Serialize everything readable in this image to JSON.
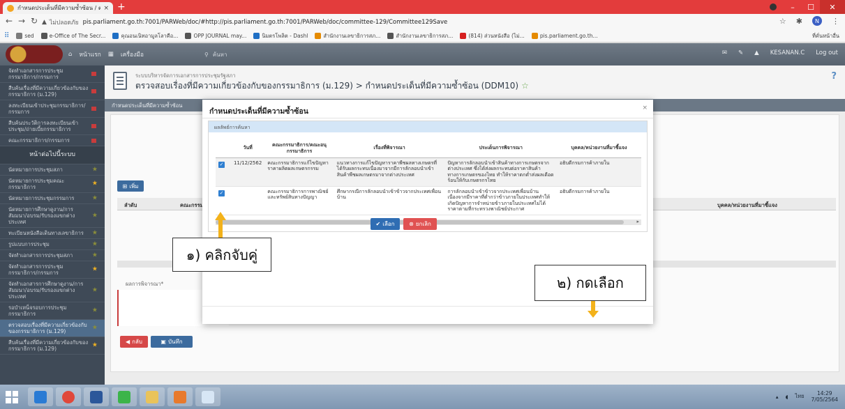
{
  "browser": {
    "tab_title": "กำหนดประเด็นที่มีความซ้ำซ้อน / ตรวจ",
    "tab_close": "×",
    "new_tab": "+",
    "not_secure": "ไม่ปลอดภัย",
    "url": "pis.parliament.go.th:7001/PARWeb/doc/#http://pis.parliament.go.th:7001/PARWeb/doc/committee-129/Committee129Save",
    "profile_initial": "N",
    "win_min": "–",
    "win_max": "☐",
    "win_close": "✕"
  },
  "bookmarks": {
    "items": [
      {
        "label": "sed",
        "color": "#7b7b7b"
      },
      {
        "label": "e-Office of The Secr...",
        "color": "#555555"
      },
      {
        "label": "คุณอนเนิทอามูลโลาคือ...",
        "color": "#1f6fc4"
      },
      {
        "label": "OPP JOURNAL may...",
        "color": "#555555"
      },
      {
        "label": "นิมตรโพลิต - Dashl",
        "color": "#1f6fc4"
      },
      {
        "label": "สำนักงานเลขาธิการสภ...",
        "color": "#e58a00"
      },
      {
        "label": "สำนักงานเลขาธิการสภ...",
        "color": "#555555"
      },
      {
        "label": "(814) ส่วนหนังสือ (ไม่...",
        "color": "#d62020"
      },
      {
        "label": "pis.parliament.go.th...",
        "color": "#e58a00"
      }
    ],
    "other": "ที่คั่นหน้าอื่น"
  },
  "app_header": {
    "home": "หน้าแรก",
    "apps": "เครื่องมือ",
    "search_placeholder": "ค้นหา",
    "user": "KESANAN.C",
    "logout": "Log out"
  },
  "sidebar": {
    "items": [
      {
        "label": "จัดทำเอกสารการประชุมกรรมาธิการ/กรรมการ",
        "mark": "red"
      },
      {
        "label": "สืบค้นเรื่องที่มีความเกี่ยวข้องกับของกรรมาธิการ (ม.129)",
        "mark": "red"
      },
      {
        "label": "ลงทะเบียนเข้าประชุมกรรมาธิการ/กรรมการ",
        "mark": "red"
      },
      {
        "label": "สืบค้นประวัติการลงทะเบียนเข้าประชุม/ถ่ายเบี้ยกรรมาธิการ",
        "mark": "red"
      },
      {
        "label": "คณะกรรมาธิการ/กรรมการ",
        "mark": "red"
      },
      {
        "label": "หน้าต่อไปนี้ระบบ",
        "mark": "head"
      },
      {
        "label": "นัดหมายการประชุมสภา",
        "mark": "star"
      },
      {
        "label": "นัดหมายการประชุมคณะกรรมาธิการ",
        "mark": "gold"
      },
      {
        "label": "นัดหมายการประชุมกรรมการ",
        "mark": "star"
      },
      {
        "label": "นัดหมายการศึกษาดูงาน/การสัมมนา/อบรม/รับรองแขกต่างประเทศ",
        "mark": "star"
      },
      {
        "label": "ทะเบียนหนังสือเดินทางเลขาธิการ",
        "mark": "star"
      },
      {
        "label": "รูปแบบการประชุม",
        "mark": "star"
      },
      {
        "label": "จัดทำเอกสารการประชุมสภา",
        "mark": "star"
      },
      {
        "label": "จัดทำเอกสารการประชุมกรรมาธิการ/กรรมการ",
        "mark": "gold"
      },
      {
        "label": "จัดทำเอกสารการศึกษาดูงาน/การสัมมนา/อบรม/รับรองแขกต่างประเทศ",
        "mark": "star"
      },
      {
        "label": "รอบำเหน็จรอบการประชุมกรรมาธิการ",
        "mark": "star"
      },
      {
        "label": "ตรวจสอบเรื่องที่มีความเกี่ยวข้องกับของกรรมาธิการ (ม.129)",
        "mark": "active"
      },
      {
        "label": "สืบค้นเรื่องที่มีความเกี่ยวข้องกับของกรรมาธิการ (ม.129)",
        "mark": "gold"
      }
    ]
  },
  "page": {
    "crumb": "ระบบบริหารจัดการเอกสารการประชุมรัฐสภา",
    "title": "ตรวจสอบเรื่องที่มีความเกี่ยวข้องกับของกรรมาธิการ (ม.129) > กำหนดประเด็นที่มีความซ้ำซ้อน (DDM10)",
    "help": "?",
    "tab_label": "กำหนดประเด็นที่มีความซ้ำซ้อน",
    "add_label": "เพิ่ม",
    "col_seq": "ลำดับ",
    "col_committee": "คณะกรรม",
    "col_person": "บุคคล/หน่วยงานที่มาชี้แจง",
    "consider_label": "ผลการพิจารณา*",
    "back_label": "กลับ",
    "save_label": "บันทึก"
  },
  "modal": {
    "title": "กำหนดประเด็นที่มีความซ้ำซ้อน",
    "close": "×",
    "result_header": "ผลลัพธ์การค้นหา",
    "columns": [
      "วันที่",
      "คณะกรรมาธิการ/คณะอนุกรรมาธิการ",
      "เรื่องที่พิจารณา",
      "ประเด็นการพิจารณา",
      "บุคคล/หน่วยงานที่มาชี้แจง"
    ],
    "rows": [
      {
        "checked": true,
        "date": "11/12/2562",
        "committee": "คณะกรรมาธิการแก้ไขปัญหาราคาผลิตผลเกษตรกรรม",
        "subject": "แนวทางการแก้ไขปัญหาราคาพืชผลทางเกษตรที่ได้รับผลกระทบเนื่องมาจากมีการลักลอบนำเข้าสินค้าพืชผลเกษตรมาจากต่างประเทศ",
        "issue": "ปัญหาการลักลอบนำเข้าสินค้าทางการเกษตรจากต่างประเทศ ซึ่งได้ส่งผลกระทบต่อราคาสินค้าทางการเกษตรของไทย ทำให้ราคาตกต่ำส่งผลเดือดร้อนให้กับเกษตรกรไทย",
        "person": "อธิบดีกรมการค้าภายใน"
      },
      {
        "checked": true,
        "date": "",
        "committee": "คณะกรรมาธิการการพาณิชย์และทรัพย์สินทางปัญญา",
        "subject": "ศึกษากรณีการลักลอบนำเข้าข้าวจากประเทศเพื่อนบ้าน",
        "issue": "การลักลอบนำเข้าข้าวจากประเทศเพื่อนบ้าน เนื่องจากมีราคาที่ต่ำกว่าข้าวภายในประเทศทำให้เกิดปัญหาการจำหน่ายข้าวภายในประเทศไม่ได้ราคาตามที่กระทรวงพาณิชย์ประกาศ",
        "person": "อธิบดีกรมการค้าภายใน"
      }
    ],
    "select_label": "เลือก",
    "cancel_label": "ยกเลิก"
  },
  "annotations": {
    "step1": "๑) คลิกจับคู่",
    "step2": "๒) กดเลือก",
    "arrow_color": "#f3b21b"
  },
  "taskbar": {
    "time": "14:29",
    "date": "7/05/2564",
    "lang": "ไทย"
  }
}
